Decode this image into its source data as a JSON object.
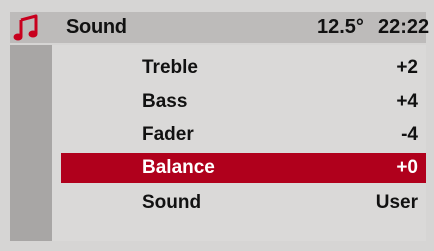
{
  "header": {
    "icon": "music-note-icon",
    "title": "Sound",
    "temperature": "12.5°",
    "time": "22:22"
  },
  "colors": {
    "accent": "#b0001c",
    "header_bg": "#bdbbba",
    "sidebar_bg": "#a8a6a5",
    "content_bg": "#dad9d8"
  },
  "menu": {
    "selected_index": 3,
    "items": [
      {
        "label": "Treble",
        "value": "+2"
      },
      {
        "label": "Bass",
        "value": "+4"
      },
      {
        "label": "Fader",
        "value": "-4"
      },
      {
        "label": "Balance",
        "value": "+0"
      },
      {
        "label": "Sound",
        "value": "User"
      }
    ]
  }
}
